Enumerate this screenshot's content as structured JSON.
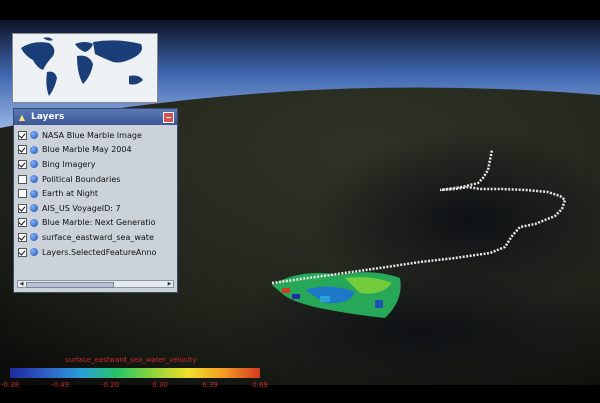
{
  "layers_panel": {
    "title": "Layers",
    "items": [
      {
        "label": "NASA Blue Marble Image",
        "checked": true
      },
      {
        "label": "Blue Marble May 2004",
        "checked": true
      },
      {
        "label": "Bing Imagery",
        "checked": true
      },
      {
        "label": "Political Boundaries",
        "checked": false
      },
      {
        "label": "Earth at Night",
        "checked": false
      },
      {
        "label": "AIS_US VoyageID: 7",
        "checked": true
      },
      {
        "label": "Blue Marble: Next Generatio",
        "checked": true
      },
      {
        "label": "surface_eastward_sea_wate",
        "checked": true
      },
      {
        "label": "Layers.SelectedFeatureAnno",
        "checked": true
      }
    ]
  },
  "legend": {
    "title": "surface_eastward_sea_water_velocity",
    "ticks": [
      "-0.38",
      "-0.49",
      "-0.20",
      "0.30",
      "6.39",
      "0.69"
    ],
    "colors": [
      "#1c2a9c",
      "#2f5ec8",
      "#2a9fd8",
      "#27c468",
      "#8fd43a",
      "#f2de2a",
      "#f39a22",
      "#d43a20"
    ]
  },
  "colors": {
    "panel_title": "#3b5894",
    "legend_text": "#c8282e",
    "ship_track": "#e6e6e6"
  }
}
